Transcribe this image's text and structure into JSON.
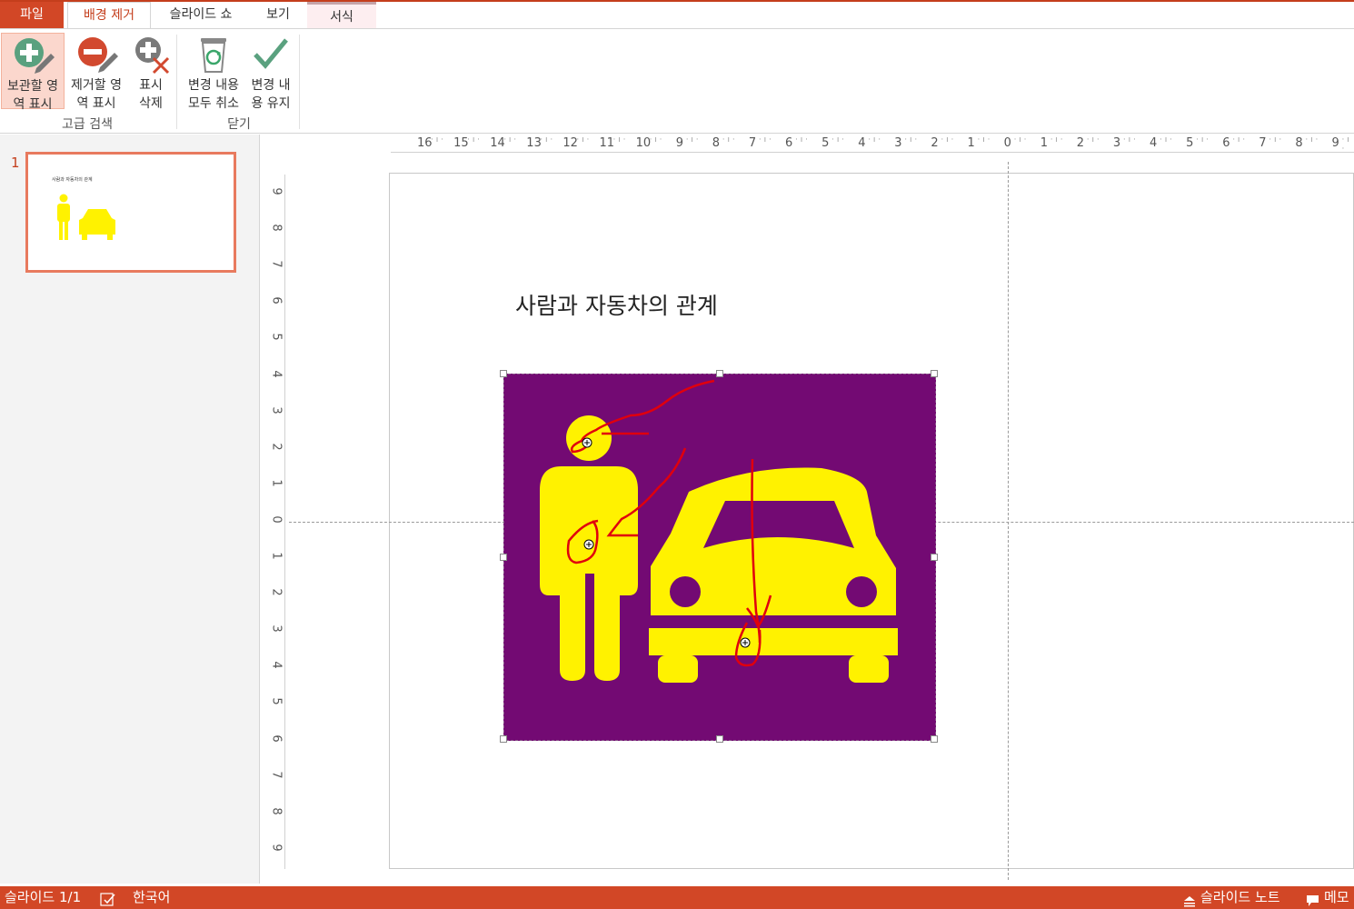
{
  "tabs": {
    "file": "파일",
    "background_removal": "배경 제거",
    "slide_show": "슬라이드 쇼",
    "view": "보기",
    "format": "서식"
  },
  "ribbon": {
    "mark_keep": "보관할 영\n역 표시",
    "mark_remove": "제거할 영\n역 표시",
    "delete_mark": "표시\n삭제",
    "discard_changes": "변경 내용\n모두 취소",
    "keep_changes": "변경 내\n용 유지",
    "group_refine": "고급 검색",
    "group_close": "닫기"
  },
  "thumbnails": [
    {
      "number": "1",
      "title": "사람과 자동차의 관계"
    }
  ],
  "rulers": {
    "horizontal": [
      "16",
      "15",
      "14",
      "13",
      "12",
      "11",
      "10",
      "9",
      "8",
      "7",
      "6",
      "5",
      "4",
      "3",
      "2",
      "1",
      "0",
      "1",
      "2",
      "3",
      "4",
      "5",
      "6",
      "7",
      "8",
      "9"
    ],
    "vertical": [
      "9",
      "8",
      "7",
      "6",
      "5",
      "4",
      "3",
      "2",
      "1",
      "0",
      "1",
      "2",
      "3",
      "4",
      "5",
      "6",
      "7",
      "8",
      "9"
    ]
  },
  "slide": {
    "title": "사람과 자동차의 관계"
  },
  "status": {
    "slide_counter": "슬라이드 1/1",
    "language": "한국어",
    "notes": "슬라이드 노트",
    "comments": "메모"
  },
  "colors": {
    "accent": "#d24726",
    "image_background": "#730a73",
    "image_foreground": "#fff200",
    "mark_stroke": "#e0000d"
  },
  "icons": {
    "mark_keep": "plus-pencil-icon",
    "mark_remove": "minus-pencil-icon",
    "delete_mark": "delete-mark-icon",
    "discard": "recycle-bin-icon",
    "keep": "checkmark-icon",
    "notes": "notes-icon",
    "comments": "comment-icon",
    "spellcheck": "spellcheck-icon"
  }
}
